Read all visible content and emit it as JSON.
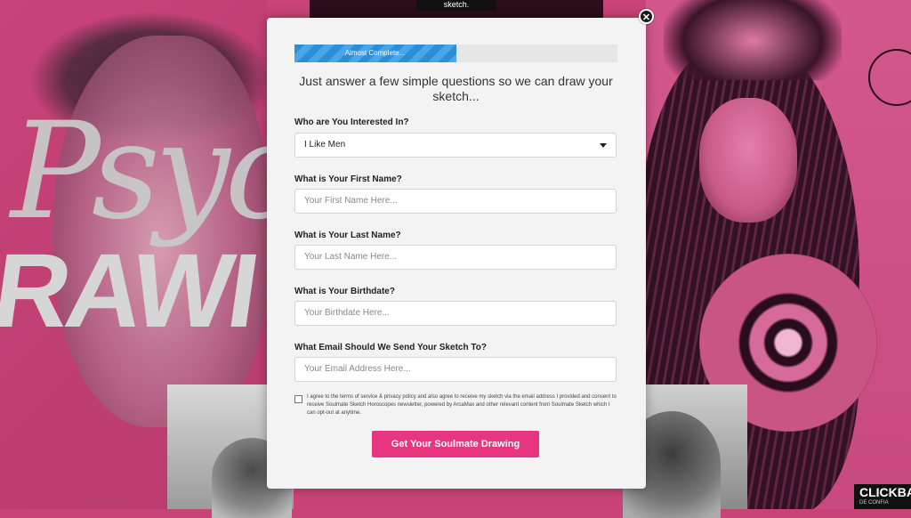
{
  "background": {
    "left_title_line1": "Psyc",
    "left_title_line2": "RAWI",
    "top_logo": "sketch.",
    "badge_main": "CLICKBA",
    "badge_sub": "DE CONFIA"
  },
  "modal": {
    "close_glyph": "✕",
    "progress": {
      "label": "Almost Complete...",
      "percent": 50
    },
    "headline": "Just answer a few simple questions so we can draw your sketch...",
    "interest": {
      "label": "Who are You Interested In?",
      "selected": "I Like Men"
    },
    "first_name": {
      "label": "What is Your First Name?",
      "placeholder": "Your First Name Here..."
    },
    "last_name": {
      "label": "What is Your Last Name?",
      "placeholder": "Your Last Name Here..."
    },
    "birthdate": {
      "label": "What is Your Birthdate?",
      "placeholder": "Your Birthdate Here..."
    },
    "email": {
      "label": "What Email Should We Send Your Sketch To?",
      "placeholder": "Your Email Address Here..."
    },
    "consent_text": "I agree to the terms of service & privacy policy and also agree to receive my sketch via the email address I provided and consent to receive Soulmate Sketch Horoscopes newsletter, powered by ArcaMax and other relevant content from Soulmate Sketch which I can opt-out at anytime.",
    "cta_label": "Get Your Soulmate Drawing"
  },
  "colors": {
    "background_pink": "#c94376",
    "progress_blue": "#2a8fd6",
    "cta_pink": "#e8357f"
  }
}
